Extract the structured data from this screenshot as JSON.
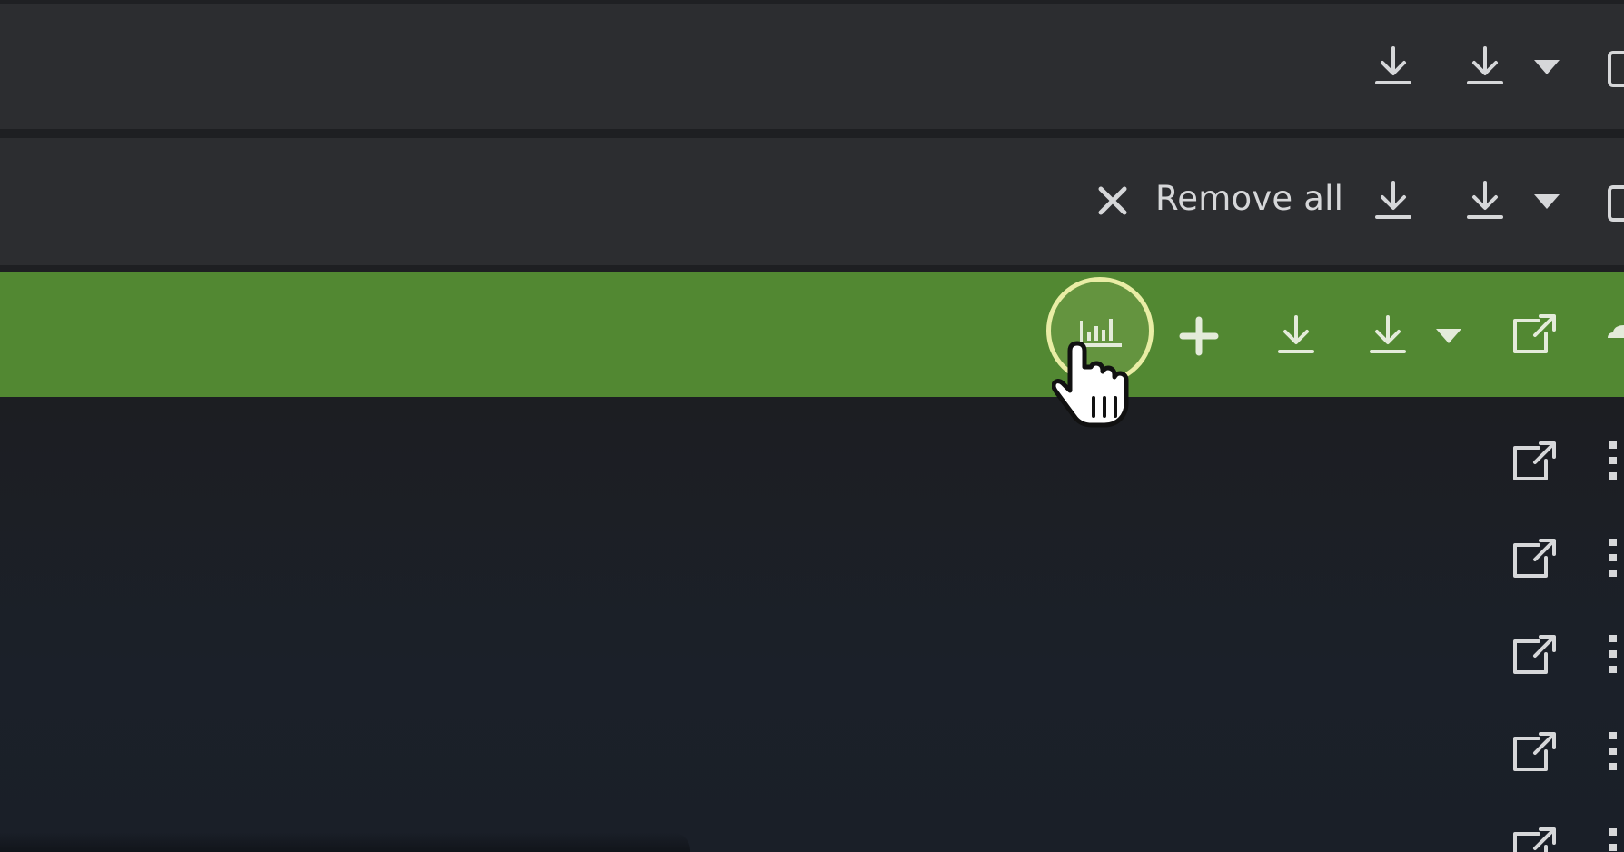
{
  "toolbar_row_1": {
    "icons": [
      "download-icon",
      "download-icon",
      "caret-down-icon",
      "checkbox-icon"
    ]
  },
  "toolbar_row_2": {
    "remove_all_label": "Remove all",
    "icons": [
      "close-icon",
      "download-icon",
      "download-icon",
      "caret-down-icon",
      "checkbox-icon"
    ]
  },
  "toolbar_row_3": {
    "icons": [
      "bar-chart-icon",
      "plus-icon",
      "download-icon",
      "download-icon",
      "caret-down-icon",
      "external-link-icon"
    ]
  },
  "list_rows": {
    "icons": [
      "external-link-icon",
      "drag-handle-icon"
    ],
    "count_visible": 5
  },
  "colors": {
    "active_row": "#528832",
    "row_bg": "#2c2d30",
    "page_bg": "#1b1e23",
    "icon": "#d6d7d9",
    "highlight": "#e9eda5"
  }
}
